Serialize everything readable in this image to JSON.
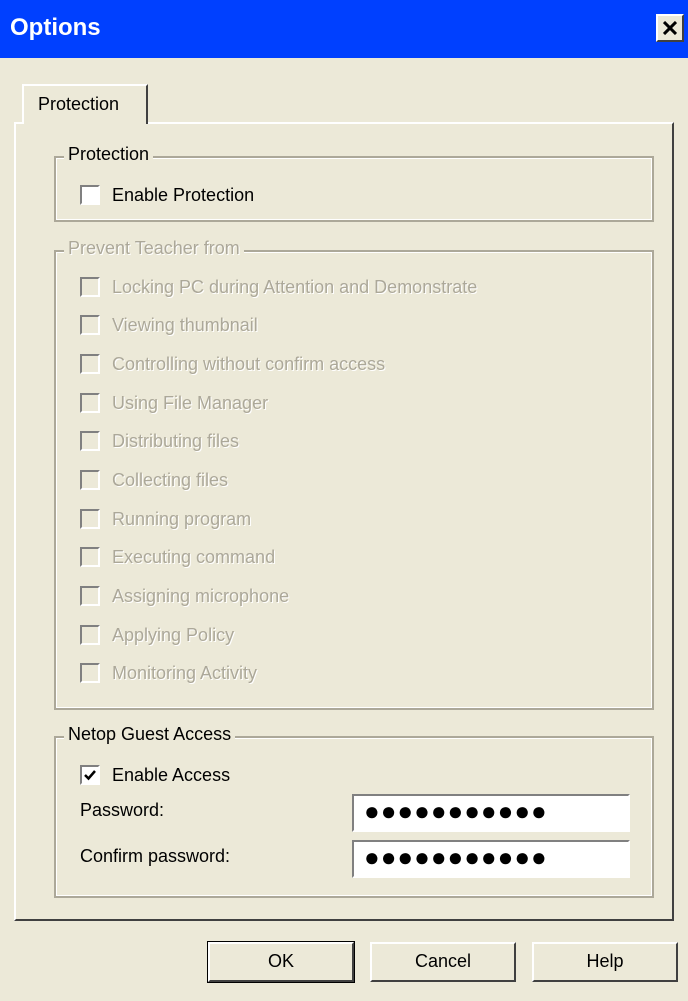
{
  "window": {
    "title": "Options"
  },
  "tabs": [
    {
      "label": "Protection"
    }
  ],
  "protection_group": {
    "legend": "Protection",
    "enable_protection": {
      "label": "Enable Protection",
      "checked": false
    }
  },
  "prevent_group": {
    "legend": "Prevent Teacher from",
    "items": [
      {
        "label": "Locking PC during Attention and Demonstrate",
        "checked": false
      },
      {
        "label": "Viewing thumbnail",
        "checked": false
      },
      {
        "label": "Controlling without confirm access",
        "checked": false
      },
      {
        "label": "Using File Manager",
        "checked": false
      },
      {
        "label": "Distributing files",
        "checked": false
      },
      {
        "label": "Collecting files",
        "checked": false
      },
      {
        "label": "Running program",
        "checked": false
      },
      {
        "label": "Executing command",
        "checked": false
      },
      {
        "label": "Assigning microphone",
        "checked": false
      },
      {
        "label": "Applying Policy",
        "checked": false
      },
      {
        "label": "Monitoring Activity",
        "checked": false
      }
    ]
  },
  "guest_group": {
    "legend": "Netop Guest Access",
    "enable_access": {
      "label": "Enable Access",
      "checked": true
    },
    "password_label": "Password:",
    "password_value": "●●●●●●●●●●●",
    "confirm_label": "Confirm password:",
    "confirm_value": "●●●●●●●●●●●"
  },
  "buttons": {
    "ok": "OK",
    "cancel": "Cancel",
    "help": "Help"
  },
  "colors": {
    "titlebar": "#0040ff",
    "dialog_bg": "#ece9d8",
    "disabled_text": "#aca899"
  }
}
